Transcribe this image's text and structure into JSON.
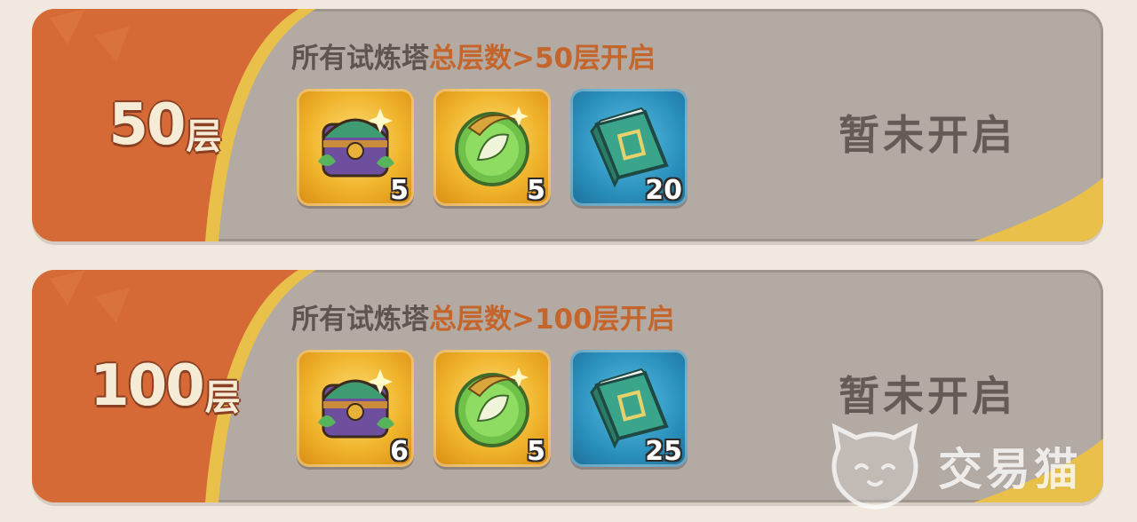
{
  "tiers": [
    {
      "tier_number": "50",
      "tier_unit": "层",
      "condition_prefix": "所有试炼塔",
      "condition_highlight": "总层数>50层开启",
      "rewards": [
        {
          "icon": "treasure-chest-icon",
          "qty": "5",
          "style": "gold"
        },
        {
          "icon": "green-orb-icon",
          "qty": "5",
          "style": "gold"
        },
        {
          "icon": "skill-book-icon",
          "qty": "20",
          "style": "blue"
        }
      ],
      "status": "暂未开启"
    },
    {
      "tier_number": "100",
      "tier_unit": "层",
      "condition_prefix": "所有试炼塔",
      "condition_highlight": "总层数>100层开启",
      "rewards": [
        {
          "icon": "treasure-chest-icon",
          "qty": "6",
          "style": "gold"
        },
        {
          "icon": "green-orb-icon",
          "qty": "5",
          "style": "gold"
        },
        {
          "icon": "skill-book-icon",
          "qty": "25",
          "style": "blue"
        }
      ],
      "status": "暂未开启"
    }
  ],
  "watermark": {
    "text": "交易猫",
    "icon": "cat-logo-icon"
  },
  "colors": {
    "card_bg": "#b4aaa4",
    "tier_orange": "#d56a36",
    "gold_accent": "#e8c04a",
    "highlight_text": "#c4662b",
    "status_text": "#655b56"
  }
}
